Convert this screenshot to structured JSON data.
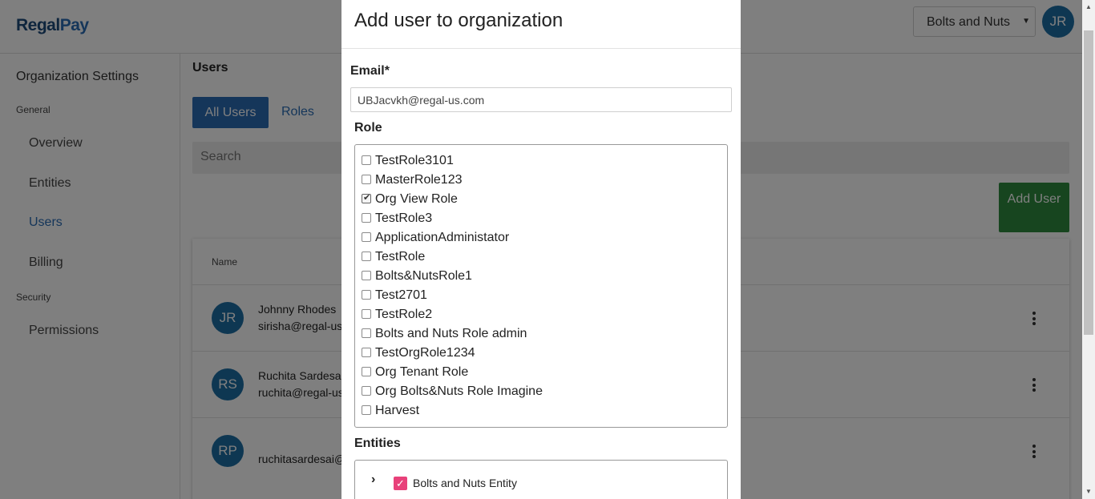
{
  "topbar": {
    "logo_part1": "Regal",
    "logo_part2": "Pay",
    "org_selected": "Bolts and Nuts",
    "avatar_initials": "JR"
  },
  "sidebar": {
    "title": "Organization Settings",
    "sections": [
      {
        "label": "General",
        "items": [
          "Overview",
          "Entities",
          "Users",
          "Billing"
        ]
      },
      {
        "label": "Security",
        "items": [
          "Permissions"
        ]
      }
    ],
    "active_item": "Users"
  },
  "main": {
    "title": "Users",
    "tabs": [
      "All Users",
      "Roles"
    ],
    "search_placeholder": "Search",
    "add_user_label": "Add User",
    "table_header_name": "Name",
    "rows": [
      {
        "initials": "JR",
        "name": "Johnny Rhodes",
        "email": "sirisha@regal-us"
      },
      {
        "initials": "RS",
        "name": "Ruchita Sardesai",
        "email": "ruchita@regal-us"
      },
      {
        "initials": "RP",
        "name": "",
        "email": "ruchitasardesai@"
      }
    ]
  },
  "modal": {
    "title": "Add user to organization",
    "email_label": "Email*",
    "email_value": "UBJacvkh@regal-us.com",
    "role_label": "Role",
    "roles": [
      {
        "name": "TestRole3101",
        "checked": false
      },
      {
        "name": "MasterRole123",
        "checked": false
      },
      {
        "name": "Org View Role",
        "checked": true
      },
      {
        "name": "TestRole3",
        "checked": false
      },
      {
        "name": "ApplicationAdministator",
        "checked": false
      },
      {
        "name": "TestRole",
        "checked": false
      },
      {
        "name": "Bolts&NutsRole1",
        "checked": false
      },
      {
        "name": "Test2701",
        "checked": false
      },
      {
        "name": "TestRole2",
        "checked": false
      },
      {
        "name": "Bolts and Nuts Role admin",
        "checked": false
      },
      {
        "name": "TestOrgRole1234",
        "checked": false
      },
      {
        "name": "Org Tenant Role",
        "checked": false
      },
      {
        "name": "Org Bolts&Nuts Role Imagine",
        "checked": false
      },
      {
        "name": "Harvest",
        "checked": false
      }
    ],
    "entities_label": "Entities",
    "entities": [
      {
        "name": "Bolts and Nuts Entity",
        "checked": true
      }
    ]
  },
  "colors": {
    "primary": "#2a6cb5",
    "success": "#2e8b3e",
    "avatar": "#1d6fa5",
    "entity_check": "#e8417a"
  }
}
